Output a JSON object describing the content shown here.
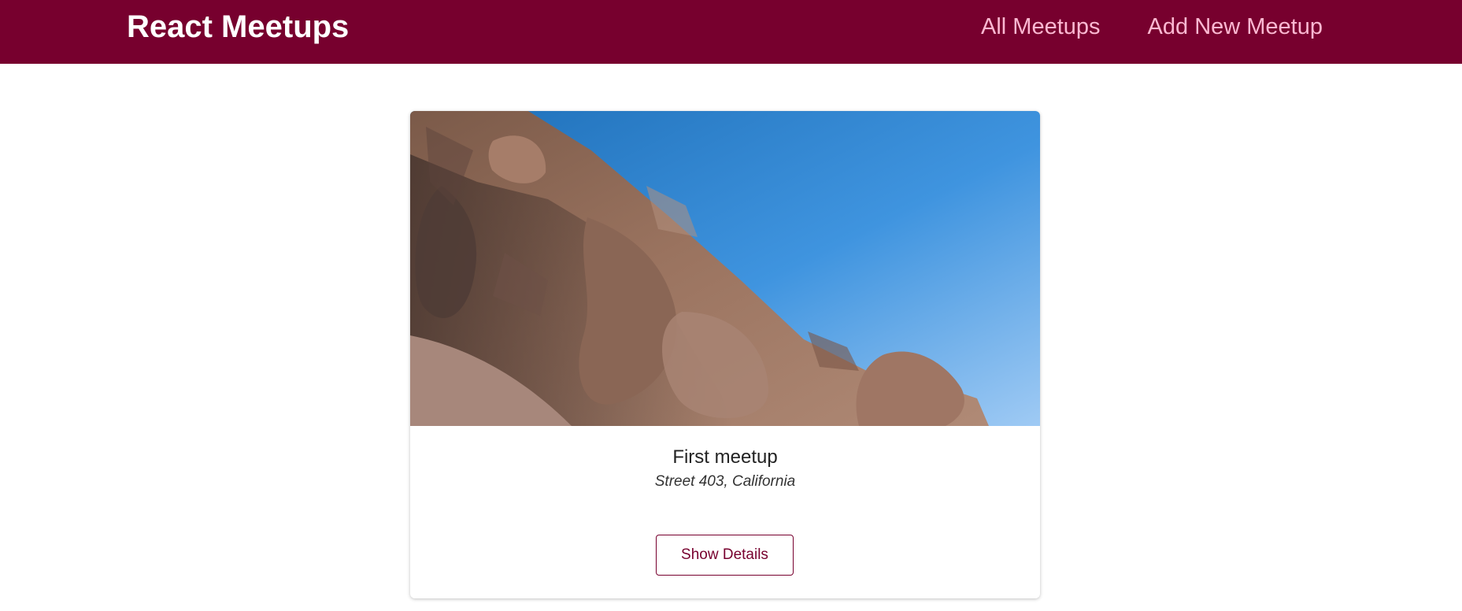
{
  "header": {
    "logo": "React Meetups",
    "nav": [
      {
        "label": "All Meetups"
      },
      {
        "label": "Add New Meetup"
      }
    ]
  },
  "meetups": [
    {
      "title": "First meetup",
      "address": "Street 403, California",
      "details_label": "Show Details",
      "image": "rock-formation-photo"
    }
  ],
  "colors": {
    "header_bg": "#77002e",
    "nav_text": "#fcb8d2",
    "button_border": "#77002e",
    "sky_blue": "#3f8fd6",
    "rock_brown": "#94705d"
  }
}
